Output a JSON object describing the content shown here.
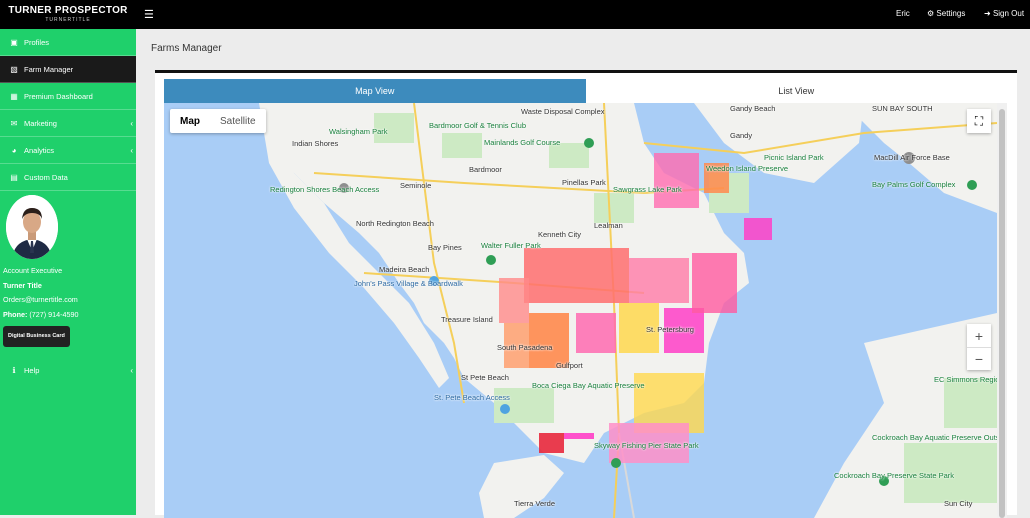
{
  "brand": {
    "title": "TURNER PROSPECTOR",
    "sub": "TURNERTITLE"
  },
  "topnav": {
    "user": "Eric",
    "settings": "Settings",
    "signout": "Sign Out"
  },
  "sidebar": {
    "items": [
      {
        "label": "Profiles"
      },
      {
        "label": "Farm Manager"
      },
      {
        "label": "Premium Dashboard"
      },
      {
        "label": "Marketing"
      },
      {
        "label": "Analytics"
      },
      {
        "label": "Custom Data"
      }
    ],
    "help": "Help"
  },
  "profile": {
    "role": "Account Executive",
    "name": "Turner Title",
    "email": "Orders@turnertitle.com",
    "phone_label": "Phone:",
    "phone": "(727) 914-4590",
    "card_button": "Digital Business Card"
  },
  "page": {
    "title": "Farms Manager"
  },
  "tabs": {
    "map": "Map View",
    "list": "List View"
  },
  "map": {
    "type_map": "Map",
    "type_satellite": "Satellite",
    "zoom_in": "+",
    "zoom_out": "−",
    "labels": [
      {
        "text": "Walsingham Park",
        "kind": "g"
      },
      {
        "text": "Bardmoor Golf & Tennis Club",
        "kind": "g"
      },
      {
        "text": "Indian Shores",
        "kind": ""
      },
      {
        "text": "Mainlands Golf Course",
        "kind": "g"
      },
      {
        "text": "Bardmoor",
        "kind": ""
      },
      {
        "text": "Seminole",
        "kind": ""
      },
      {
        "text": "Pinellas Park",
        "kind": ""
      },
      {
        "text": "Redington Shores Beach Access",
        "kind": "g"
      },
      {
        "text": "North Redington Beach",
        "kind": ""
      },
      {
        "text": "Bay Pines",
        "kind": ""
      },
      {
        "text": "Walter Fuller Park",
        "kind": "g"
      },
      {
        "text": "Kenneth City",
        "kind": ""
      },
      {
        "text": "Lealman",
        "kind": ""
      },
      {
        "text": "Madeira Beach",
        "kind": ""
      },
      {
        "text": "John's Pass Village & Boardwalk",
        "kind": "b"
      },
      {
        "text": "Treasure Island",
        "kind": ""
      },
      {
        "text": "St. Petersburg",
        "kind": ""
      },
      {
        "text": "South Pasadena",
        "kind": ""
      },
      {
        "text": "Gulfport",
        "kind": ""
      },
      {
        "text": "St Pete Beach",
        "kind": ""
      },
      {
        "text": "Boca Ciega Bay Aquatic Preserve",
        "kind": "g"
      },
      {
        "text": "St. Pete Beach Access",
        "kind": "b"
      },
      {
        "text": "Gandy Beach",
        "kind": ""
      },
      {
        "text": "Gandy",
        "kind": ""
      },
      {
        "text": "Picnic Island Park",
        "kind": "g"
      },
      {
        "text": "MacDill Air Force Base",
        "kind": ""
      },
      {
        "text": "Bay Palms Golf Complex",
        "kind": "g"
      },
      {
        "text": "Weedon Island Preserve",
        "kind": "g"
      },
      {
        "text": "Sawgrass Lake Park",
        "kind": "g"
      },
      {
        "text": "EC Simmons Regional Park",
        "kind": "g"
      },
      {
        "text": "Cockroach Bay Aquatic Preserve Outstanding",
        "kind": "g"
      },
      {
        "text": "Cockroach Bay Preserve State Park",
        "kind": "g"
      },
      {
        "text": "Tierra Verde",
        "kind": ""
      },
      {
        "text": "Skyway Fishing Pier State Park",
        "kind": "g"
      },
      {
        "text": "Sun City",
        "kind": ""
      },
      {
        "text": "SUN BAY SOUTH",
        "kind": ""
      },
      {
        "text": "Waste Disposal Complex",
        "kind": ""
      }
    ]
  },
  "colors": {
    "sidebar": "#1fd06b",
    "topbar": "#000000",
    "tab_active": "#3d8bbd",
    "water": "#a9cdf6",
    "land": "#f2f2ef",
    "park": "#cdeac4"
  }
}
